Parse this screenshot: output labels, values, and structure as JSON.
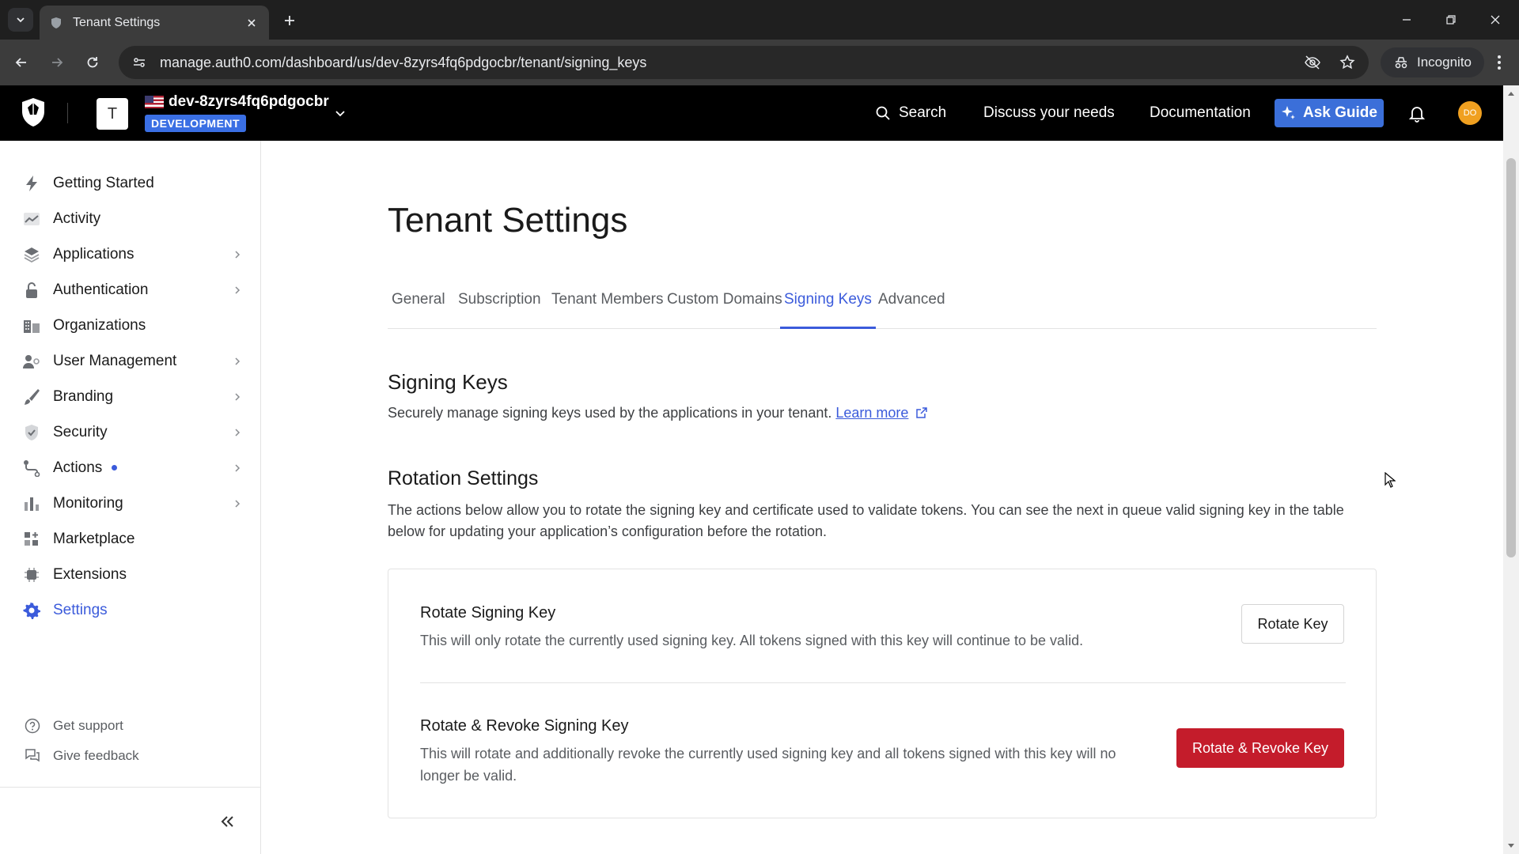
{
  "browser": {
    "tab_title": "Tenant Settings",
    "url": "manage.auth0.com/dashboard/us/dev-8zyrs4fq6pdgocbr/tenant/signing_keys",
    "incognito_label": "Incognito"
  },
  "header": {
    "tenant_initial": "T",
    "tenant_name": "dev-8zyrs4fq6pdgocbr",
    "environment_badge": "DEVELOPMENT",
    "search_label": "Search",
    "discuss_label": "Discuss your needs",
    "documentation_label": "Documentation",
    "ask_guide_label": "Ask Guide",
    "user_initials": "DO"
  },
  "sidebar": {
    "items": [
      {
        "label": "Getting Started",
        "icon": "bolt-icon"
      },
      {
        "label": "Activity",
        "icon": "activity-chart-icon"
      },
      {
        "label": "Applications",
        "icon": "layers-icon"
      },
      {
        "label": "Authentication",
        "icon": "lock-icon"
      },
      {
        "label": "Organizations",
        "icon": "building-icon"
      },
      {
        "label": "User Management",
        "icon": "users-icon"
      },
      {
        "label": "Branding",
        "icon": "brush-icon"
      },
      {
        "label": "Security",
        "icon": "shield-check-icon"
      },
      {
        "label": "Actions",
        "icon": "actions-flow-icon"
      },
      {
        "label": "Monitoring",
        "icon": "bar-chart-icon"
      },
      {
        "label": "Marketplace",
        "icon": "marketplace-grid-icon"
      },
      {
        "label": "Extensions",
        "icon": "extension-chip-icon"
      },
      {
        "label": "Settings",
        "icon": "gear-icon"
      }
    ],
    "footer": {
      "support_label": "Get support",
      "feedback_label": "Give feedback"
    }
  },
  "main": {
    "page_title": "Tenant Settings",
    "tabs": [
      {
        "label": "General"
      },
      {
        "label": "Subscription"
      },
      {
        "label": "Tenant Members"
      },
      {
        "label": "Custom Domains"
      },
      {
        "label": "Signing Keys"
      },
      {
        "label": "Advanced"
      }
    ],
    "active_tab": "Signing Keys",
    "section_title": "Signing Keys",
    "section_desc": "Securely manage signing keys used by the applications in your tenant.",
    "learn_more": "Learn more",
    "rotation_title": "Rotation Settings",
    "rotation_desc": "The actions below allow you to rotate the signing key and certificate used to validate tokens. You can see the next in queue valid signing key in the table below for updating your application’s configuration before the rotation.",
    "rotate": {
      "title": "Rotate Signing Key",
      "desc": "This will only rotate the currently used signing key. All tokens signed with this key will continue to be valid.",
      "button": "Rotate Key"
    },
    "rotate_revoke": {
      "title": "Rotate & Revoke Signing Key",
      "desc": "This will rotate and additionally revoke the currently used signing key and all tokens signed with this key will no longer be valid.",
      "button": "Rotate & Revoke Key"
    }
  },
  "colors": {
    "accent": "#3b5bdb",
    "danger": "#c41c2b",
    "badge": "#3a6fe4"
  }
}
